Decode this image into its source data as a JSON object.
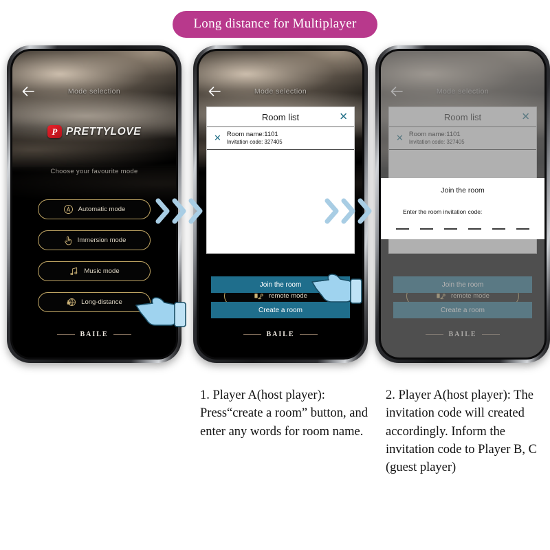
{
  "banner": {
    "text": "Long distance for Multiplayer",
    "color": "#b8398c"
  },
  "app": {
    "header_title": "Mode selection",
    "back_icon": "back-arrow-icon",
    "logo_mark": "P",
    "logo_text": "PRETTYLOVE",
    "logo_color": "#e8202a",
    "choose_text": "Choose your favourite mode",
    "footer_brand": "BAILE"
  },
  "modes": [
    {
      "label": "Automatic mode",
      "icon": "automatic-mode-icon"
    },
    {
      "label": "Immersion mode",
      "icon": "hand-touch-icon"
    },
    {
      "label": "Music mode",
      "icon": "music-note-icon"
    },
    {
      "label": "Long-distance",
      "icon": "globe-lock-icon"
    }
  ],
  "remote_mode": {
    "label": "remote mode",
    "icon": "remote-mode-icon"
  },
  "room_list": {
    "title": "Room list",
    "close_label": "✕",
    "rows": [
      {
        "remove_label": "✕",
        "name": "Room name:1101",
        "code": "Invitation code:  327405"
      }
    ]
  },
  "actions": {
    "join": "Join the room",
    "create": "Create a room",
    "button_color": "#1f6e8c"
  },
  "join_dialog": {
    "title": "Join the room",
    "label": "Enter the room invitation code:",
    "code_slots": 6
  },
  "arrows": {
    "icon": "chevron-right-icon",
    "count": 3,
    "color": "#a8cde4"
  },
  "hands": {
    "icon": "pointing-hand-icon",
    "color": "#9fd3ef"
  },
  "captions": {
    "step1": "1. Player A(host player): Press“create a room” button, and enter any words for room name.",
    "step2": "2. Player A(host player): The invitation code will created accordingly. Inform the invitation code to Player B, C (guest player)"
  }
}
